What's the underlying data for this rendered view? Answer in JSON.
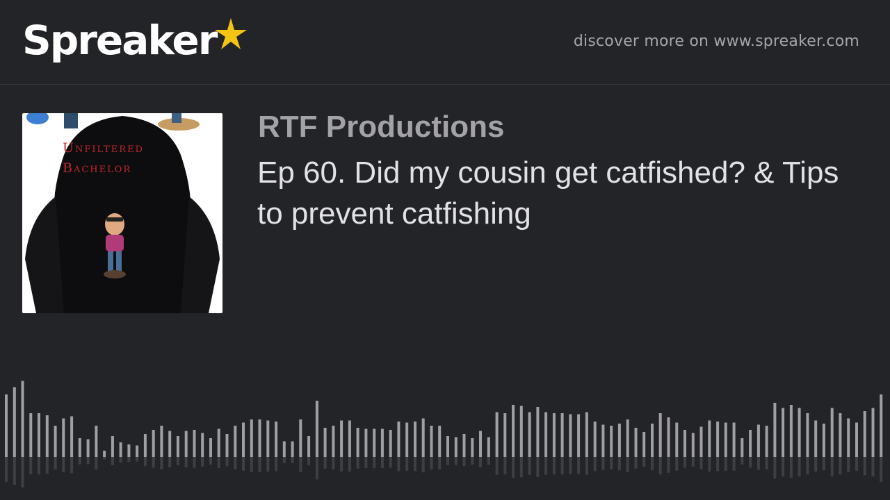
{
  "brand": {
    "name": "Spreaker",
    "star_color": "#f4c415"
  },
  "header": {
    "discover": "discover more on www.spreaker.com"
  },
  "cover": {
    "line1": "Unfiltered",
    "line2": "Bachelor"
  },
  "episode": {
    "producer": "RTF Productions",
    "title": "Ep 60. Did my cousin get catfished? & Tips to prevent catfishing"
  },
  "waveform": {
    "bar_color": "#a0a0a4",
    "levels": [
      0.6,
      0.67,
      0.73,
      0.42,
      0.42,
      0.4,
      0.3,
      0.37,
      0.39,
      0.18,
      0.17,
      0.3,
      0.06,
      0.2,
      0.14,
      0.12,
      0.11,
      0.22,
      0.26,
      0.3,
      0.25,
      0.2,
      0.25,
      0.26,
      0.23,
      0.18,
      0.27,
      0.22,
      0.3,
      0.33,
      0.36,
      0.36,
      0.35,
      0.34,
      0.15,
      0.15,
      0.36,
      0.2,
      0.54,
      0.28,
      0.3,
      0.35,
      0.35,
      0.28,
      0.27,
      0.27,
      0.27,
      0.26,
      0.34,
      0.33,
      0.34,
      0.37,
      0.3,
      0.3,
      0.2,
      0.19,
      0.22,
      0.18,
      0.25,
      0.19,
      0.43,
      0.42,
      0.5,
      0.49,
      0.43,
      0.48,
      0.43,
      0.42,
      0.42,
      0.41,
      0.41,
      0.43,
      0.34,
      0.31,
      0.3,
      0.32,
      0.36,
      0.28,
      0.24,
      0.32,
      0.42,
      0.38,
      0.33,
      0.26,
      0.23,
      0.29,
      0.35,
      0.34,
      0.33,
      0.33,
      0.18,
      0.26,
      0.31,
      0.3,
      0.52,
      0.47,
      0.5,
      0.47,
      0.42,
      0.35,
      0.32,
      0.47,
      0.42,
      0.37,
      0.33,
      0.44,
      0.47,
      0.6
    ]
  }
}
